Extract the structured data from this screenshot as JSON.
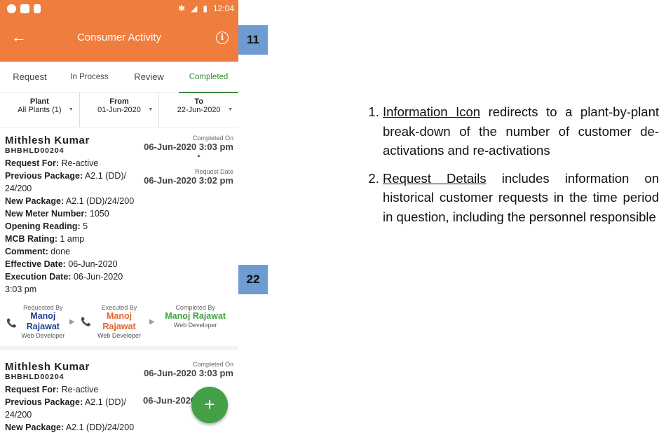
{
  "status": {
    "time": "12:04"
  },
  "appbar": {
    "title": "Consumer Activity",
    "back_icon": "arrow-left-icon",
    "info_icon": "info-icon",
    "info_glyph": "i"
  },
  "tabs": [
    {
      "label": "Request"
    },
    {
      "label": "In Process"
    },
    {
      "label": "Review"
    },
    {
      "label": "Completed",
      "active": true
    }
  ],
  "filters": {
    "plant": {
      "label": "Plant",
      "value": "All Plants (1)"
    },
    "from": {
      "label": "From",
      "value": "01-Jun-2020"
    },
    "to": {
      "label": "To",
      "value": "22-Jun-2020"
    }
  },
  "cards": [
    {
      "name": "Mithlesh Kumar",
      "code": "BHBHLD00204",
      "completed_on_label": "Completed On",
      "completed_on": "06-Jun-2020 3:03 pm",
      "request_date_label": "Request Date",
      "request_date": "06-Jun-2020 3:02 pm",
      "request_for_label": "Request For:",
      "request_for": "Re-active",
      "prev_pkg_label": "Previous Package:",
      "prev_pkg_a": "A2.1 (DD)/",
      "prev_pkg_b": "24/200",
      "new_pkg_label": "New Package:",
      "new_pkg": "A2.1 (DD)/24/200",
      "meter_label": "New Meter Number:",
      "meter": "1050",
      "opening_label": "Opening Reading:",
      "opening": "5",
      "mcb_label": "MCB Rating:",
      "mcb": "1 amp",
      "comment_label": "Comment:",
      "comment": "done",
      "effective_label": "Effective Date:",
      "effective": "06-Jun-2020",
      "execution_label": "Execution Date:",
      "execution_a": "06-Jun-2020",
      "execution_b": "3:03 pm",
      "requested_by": {
        "role": "Requested By",
        "name_a": "Manoj",
        "name_b": "Rajawat",
        "position": "Web Developer",
        "color": "#1f3f8f"
      },
      "executed_by": {
        "role": "Executed By",
        "name_a": "Manoj",
        "name_b": "Rajawat",
        "position": "Web Developer",
        "color": "#e0642a"
      },
      "completed_by": {
        "role": "Completed By",
        "name_a": "Manoj Rajawat",
        "position": "Web Developer",
        "color": "#43a047"
      }
    },
    {
      "name": "Mithlesh Kumar",
      "code": "BHBHLD00204",
      "completed_on_label": "Completed On",
      "completed_on": "06-Jun-2020 3:03 pm",
      "request_date_label": "Request Date",
      "request_date_partial": "06-Jun-2020",
      "request_date_tail": "m",
      "request_for_label": "Request For:",
      "request_for": "Re-active",
      "prev_pkg_label": "Previous Package:",
      "prev_pkg_a": "A2.1 (DD)/",
      "prev_pkg_b": "24/200",
      "new_pkg_label": "New Package:",
      "new_pkg": "A2.1 (DD)/24/200"
    }
  ],
  "fab": {
    "glyph": "+",
    "icon": "plus-icon"
  },
  "badges": {
    "first": "11",
    "second": "22"
  },
  "notes": {
    "item1_link": "Information Icon",
    "item1_text": " redirects to a plant-by-plant break-down of the number of customer de-activations and re-activations",
    "item2_link": "Request Details",
    "item2_text": " includes information on historical customer requests in the time period in question, including the personnel responsible"
  }
}
